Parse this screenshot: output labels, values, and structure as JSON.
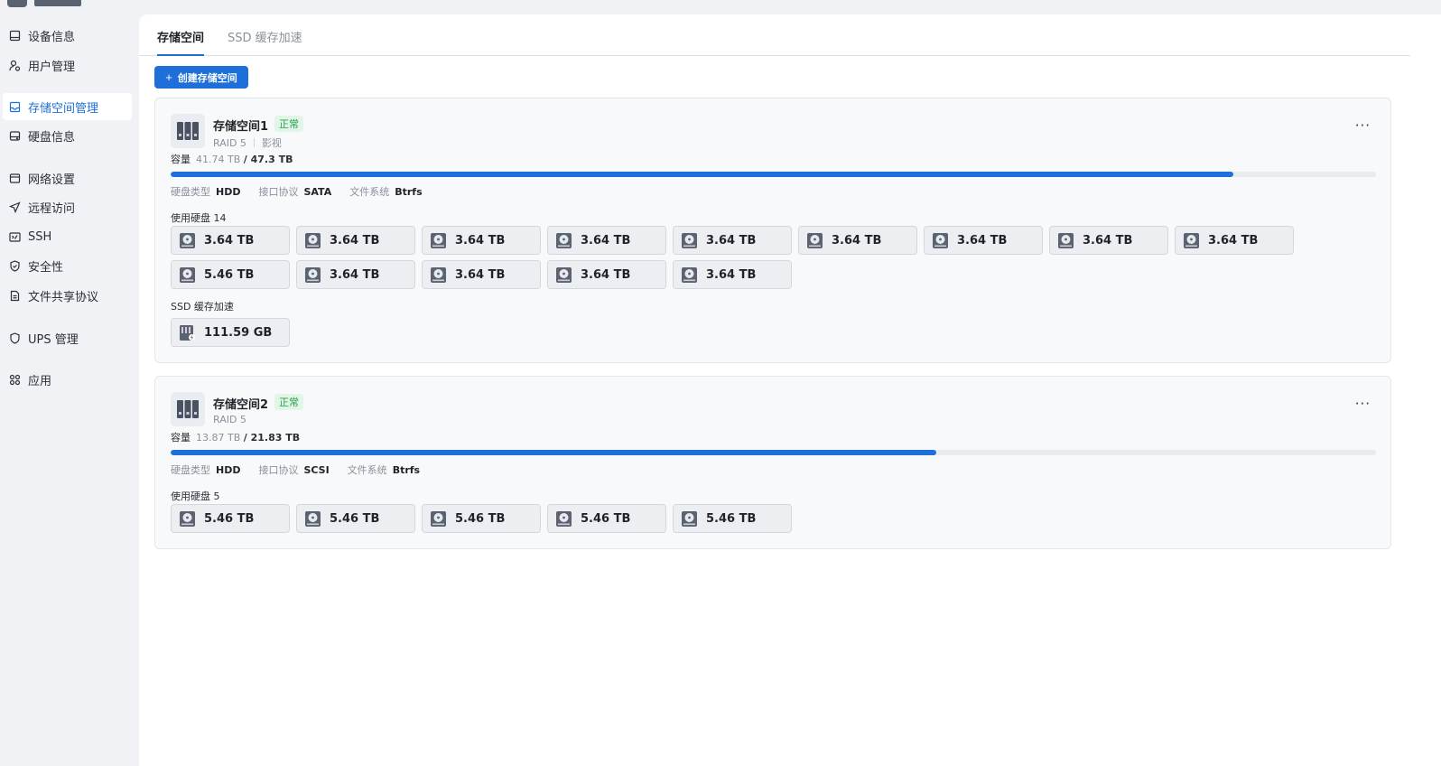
{
  "sidebar": {
    "items": [
      {
        "label": "设备信息",
        "icon": "device-icon"
      },
      {
        "label": "用户管理",
        "icon": "user-icon"
      },
      {
        "label": "存储空间管理",
        "icon": "storage-icon",
        "active": true
      },
      {
        "label": "硬盘信息",
        "icon": "disk-icon"
      },
      {
        "label": "网络设置",
        "icon": "network-icon"
      },
      {
        "label": "远程访问",
        "icon": "send-icon"
      },
      {
        "label": "SSH",
        "icon": "terminal-icon"
      },
      {
        "label": "安全性",
        "icon": "shield-check-icon"
      },
      {
        "label": "文件共享协议",
        "icon": "document-icon"
      },
      {
        "label": "UPS 管理",
        "icon": "shield-icon"
      },
      {
        "label": "应用",
        "icon": "apps-icon"
      }
    ]
  },
  "tabs": [
    {
      "label": "存储空间",
      "active": true
    },
    {
      "label": "SSD 缓存加速",
      "active": false
    }
  ],
  "create_button": {
    "plus": "+",
    "label": "创建存储空间"
  },
  "labels": {
    "capacity": "容量",
    "disk_type": "硬盘类型",
    "interface": "接口协议",
    "filesystem": "文件系统",
    "ssd_cache": "SSD 缓存加速",
    "more": "···"
  },
  "pools": [
    {
      "name": "存储空间1",
      "status": "正常",
      "raid": "RAID 5",
      "tag": "影视",
      "used": "41.74 TB",
      "total": "/ 47.3 TB",
      "usage_fraction": 0.8818,
      "disk_type": "HDD",
      "interface": "SATA",
      "filesystem": "Btrfs",
      "disks_label": "使用硬盘 14",
      "disks": [
        "3.64 TB",
        "3.64 TB",
        "3.64 TB",
        "3.64 TB",
        "3.64 TB",
        "3.64 TB",
        "3.64 TB",
        "3.64 TB",
        "3.64 TB",
        "5.46 TB",
        "3.64 TB",
        "3.64 TB",
        "3.64 TB",
        "3.64 TB"
      ],
      "ssd_cache": [
        "111.59 GB"
      ]
    },
    {
      "name": "存储空间2",
      "status": "正常",
      "raid": "RAID 5",
      "used": "13.87 TB",
      "total": "/ 21.83 TB",
      "usage_fraction": 0.6354,
      "disk_type": "HDD",
      "interface": "SCSI",
      "filesystem": "Btrfs",
      "disks_label": "使用硬盘 5",
      "disks": [
        "5.46 TB",
        "5.46 TB",
        "5.46 TB",
        "5.46 TB",
        "5.46 TB"
      ]
    }
  ],
  "colors": {
    "accent": "#1e6fd9",
    "status_ok": "#22a04b"
  }
}
